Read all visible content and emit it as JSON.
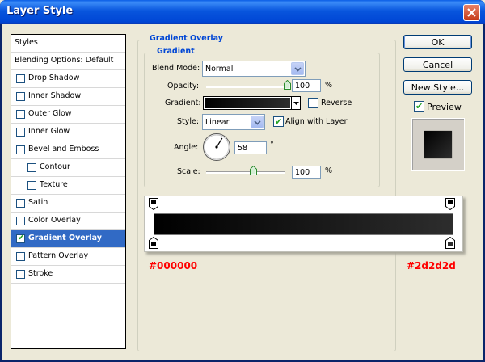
{
  "window": {
    "title": "Layer Style"
  },
  "sidebar": {
    "items": [
      {
        "label": "Styles",
        "type": "header"
      },
      {
        "label": "Blending Options: Default",
        "type": "header"
      },
      {
        "label": "Drop Shadow",
        "checked": false
      },
      {
        "label": "Inner Shadow",
        "checked": false
      },
      {
        "label": "Outer Glow",
        "checked": false
      },
      {
        "label": "Inner Glow",
        "checked": false
      },
      {
        "label": "Bevel and Emboss",
        "checked": false
      },
      {
        "label": "Contour",
        "checked": false,
        "indent": true
      },
      {
        "label": "Texture",
        "checked": false,
        "indent": true
      },
      {
        "label": "Satin",
        "checked": false
      },
      {
        "label": "Color Overlay",
        "checked": false
      },
      {
        "label": "Gradient Overlay",
        "checked": true,
        "selected": true
      },
      {
        "label": "Pattern Overlay",
        "checked": false
      },
      {
        "label": "Stroke",
        "checked": false
      }
    ]
  },
  "panel": {
    "outer_title": "Gradient Overlay",
    "inner_title": "Gradient",
    "blend_mode_label": "Blend Mode:",
    "blend_mode_value": "Normal",
    "opacity_label": "Opacity:",
    "opacity_value": "100",
    "opacity_unit": "%",
    "opacity_fraction": 1.0,
    "gradient_label": "Gradient:",
    "reverse_label": "Reverse",
    "reverse_checked": false,
    "style_label": "Style:",
    "style_value": "Linear",
    "align_label": "Align with Layer",
    "align_checked": true,
    "angle_label": "Angle:",
    "angle_value": "58",
    "angle_unit": "°",
    "scale_label": "Scale:",
    "scale_value": "100",
    "scale_unit": "%",
    "scale_fraction": 0.6
  },
  "gradient_editor": {
    "start_color": "#000000",
    "end_color": "#2d2d2d",
    "left_label": "#000000",
    "right_label": "#2d2d2d"
  },
  "buttons": {
    "ok": "OK",
    "cancel": "Cancel",
    "new_style": "New Style...",
    "preview_label": "Preview",
    "preview_checked": true
  },
  "colors": {
    "selection": "#316ac5",
    "group_title": "#0046d5",
    "annotation": "#ff0000"
  }
}
